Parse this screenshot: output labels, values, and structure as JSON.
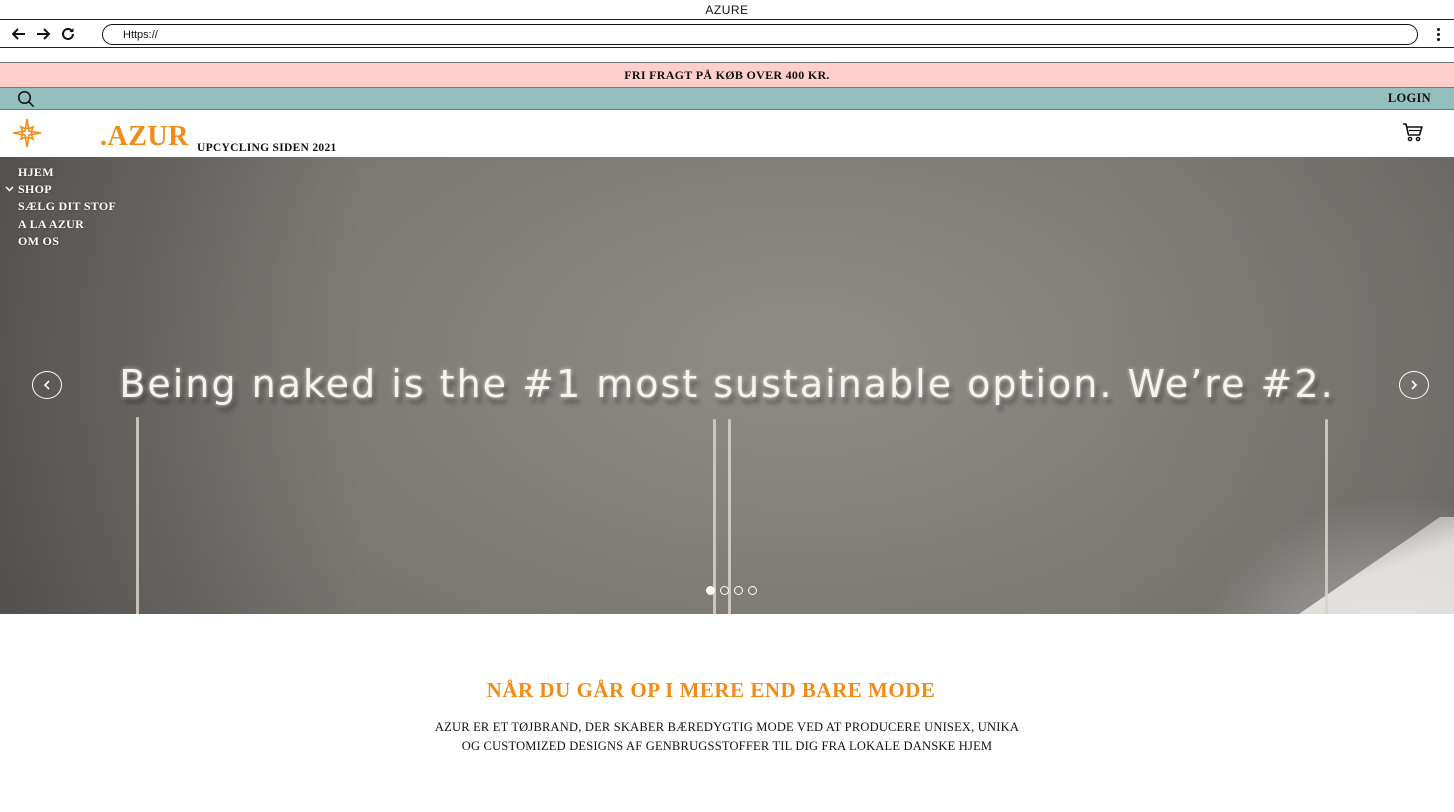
{
  "window": {
    "title": "AZURE"
  },
  "browser": {
    "url": "Https://"
  },
  "promo": {
    "text": "FRI FRAGT PÅ KØB OVER 400 KR."
  },
  "util": {
    "login": "LOGIN"
  },
  "header": {
    "brand": ".AZUR",
    "tagline": "UPCYCLING SIDEN 2021"
  },
  "nav": {
    "items": [
      {
        "label": "HJEM"
      },
      {
        "label": "SHOP"
      },
      {
        "label": "SÆLG DIT STOF"
      },
      {
        "label": "A LA AZUR"
      },
      {
        "label": "OM OS"
      }
    ]
  },
  "hero": {
    "neon_text": "Being naked is the #1 most sustainable option. We’re #2.",
    "slides_total": 4,
    "active_slide": 1
  },
  "intro": {
    "title": "NÅR DU GÅR OP I MERE END BARE MODE",
    "line1": "AZUR ER ET TØJBRAND, DER SKABER BÆREDYGTIG MODE VED AT PRODUCERE UNISEX, UNIKA",
    "line2": "OG CUSTOMIZED DESIGNS AF GENBRUGSSTOFFER TIL DIG FRA LOKALE DANSKE HJEM"
  },
  "colors": {
    "accent": "#f28b18",
    "promo_bg": "#ffcfcc",
    "util_bg": "#94bfbf"
  },
  "icons": [
    "back-arrow-icon",
    "forward-arrow-icon",
    "reload-icon",
    "menu-dots-icon",
    "search-icon",
    "compass-star-logo-icon",
    "cart-icon",
    "chevron-down-icon",
    "chevron-left-icon",
    "chevron-right-icon"
  ]
}
